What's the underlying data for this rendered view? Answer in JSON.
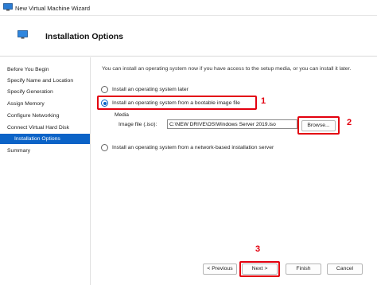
{
  "window": {
    "title": "New Virtual Machine Wizard",
    "icon": "hyper-v-monitor-icon"
  },
  "header": {
    "title": "Installation Options",
    "icon": "monitor-icon"
  },
  "sidebar": {
    "items": [
      {
        "label": "Before You Begin",
        "active": false
      },
      {
        "label": "Specify Name and Location",
        "active": false
      },
      {
        "label": "Specify Generation",
        "active": false
      },
      {
        "label": "Assign Memory",
        "active": false
      },
      {
        "label": "Configure Networking",
        "active": false
      },
      {
        "label": "Connect Virtual Hard Disk",
        "active": false
      },
      {
        "label": "Installation Options",
        "active": true
      },
      {
        "label": "Summary",
        "active": false
      }
    ]
  },
  "main": {
    "description": "You can install an operating system now if you have access to the setup media, or you can install it later.",
    "options": [
      {
        "label": "Install an operating system later",
        "selected": false
      },
      {
        "label": "Install an operating system from a bootable image file",
        "selected": true
      },
      {
        "label": "Install an operating system from a network-based installation server",
        "selected": false
      }
    ],
    "media": {
      "legend": "Media",
      "image_file_label": "Image file (.iso):",
      "image_file_value": "C:\\NEW DRIVE\\OS\\Windows Server 2019.iso",
      "browse_label": "Browse..."
    }
  },
  "footer": {
    "previous_label": "< Previous",
    "next_label": "Next >",
    "finish_label": "Finish",
    "cancel_label": "Cancel"
  },
  "annotations": {
    "color": "#e3000f",
    "step1": "1",
    "step2": "2",
    "step3": "3"
  },
  "colors": {
    "accent": "#0b63c7",
    "highlight": "#e3000f"
  }
}
